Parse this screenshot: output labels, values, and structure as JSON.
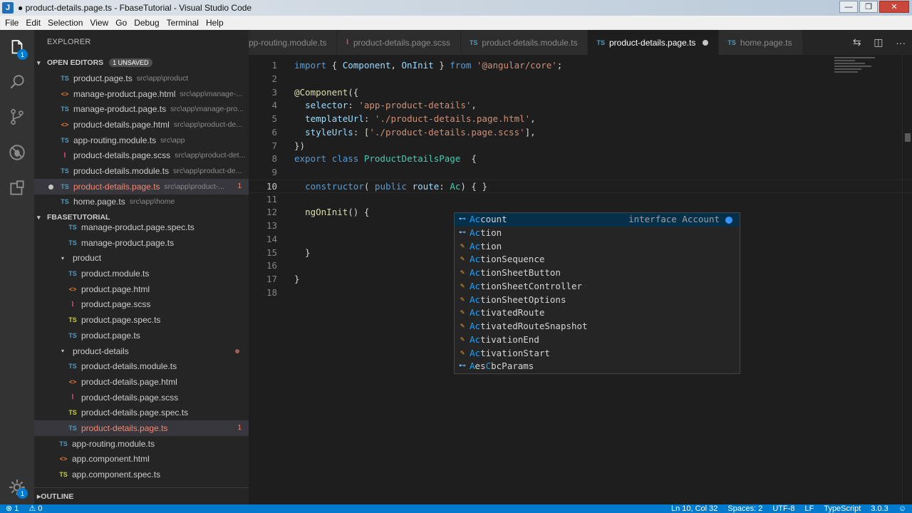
{
  "window": {
    "title": "● product-details.page.ts - FbaseTutorial - Visual Studio Code",
    "app_icon": "J",
    "controls": [
      "—",
      "❐",
      "✕"
    ]
  },
  "menu": [
    "File",
    "Edit",
    "Selection",
    "View",
    "Go",
    "Debug",
    "Terminal",
    "Help"
  ],
  "activity": {
    "explorer_badge": "1",
    "settings_badge": "1",
    "icons": [
      "files-icon",
      "search-icon",
      "source-control-icon",
      "debug-icon",
      "extensions-icon",
      "gear-icon"
    ]
  },
  "sidebar": {
    "title": "EXPLORER",
    "open_editors": {
      "label": "OPEN EDITORS",
      "badge": "1 UNSAVED",
      "items": [
        {
          "icon": "TS",
          "type": "ts",
          "name": "product.page.ts",
          "path": "src\\app\\product"
        },
        {
          "icon": "<>",
          "type": "html",
          "name": "manage-product.page.html",
          "path": "src\\app\\manage-..."
        },
        {
          "icon": "TS",
          "type": "ts",
          "name": "manage-product.page.ts",
          "path": "src\\app\\manage-pro..."
        },
        {
          "icon": "<>",
          "type": "html",
          "name": "product-details.page.html",
          "path": "src\\app\\product-de..."
        },
        {
          "icon": "TS",
          "type": "ts",
          "name": "app-routing.module.ts",
          "path": "src\\app"
        },
        {
          "icon": "⌇",
          "type": "scss",
          "name": "product-details.page.scss",
          "path": "src\\app\\product-det..."
        },
        {
          "icon": "TS",
          "type": "ts",
          "name": "product-details.module.ts",
          "path": "src\\app\\product-de..."
        },
        {
          "icon": "TS",
          "type": "ts",
          "name": "product-details.page.ts",
          "path": "src\\app\\product-...",
          "count": "1",
          "modified": true,
          "selected": true
        },
        {
          "icon": "TS",
          "type": "ts",
          "name": "home.page.ts",
          "path": "src\\app\\home"
        }
      ]
    },
    "workspace": {
      "label": "FBASETUTORIAL",
      "items": [
        {
          "icon": "TS",
          "type": "ts",
          "name": "manage-product.page.spec.ts",
          "indent": 2
        },
        {
          "icon": "TS",
          "type": "ts",
          "name": "manage-product.page.ts",
          "indent": 2
        },
        {
          "icon": "▾",
          "type": "folder",
          "name": "product",
          "indent": 1
        },
        {
          "icon": "TS",
          "type": "ts",
          "name": "product.module.ts",
          "indent": 2
        },
        {
          "icon": "<>",
          "type": "html",
          "name": "product.page.html",
          "indent": 2
        },
        {
          "icon": "⌇",
          "type": "scss",
          "name": "product.page.scss",
          "indent": 2
        },
        {
          "icon": "TS",
          "type": "spec",
          "name": "product.page.spec.ts",
          "indent": 2
        },
        {
          "icon": "TS",
          "type": "ts",
          "name": "product.page.ts",
          "indent": 2
        },
        {
          "icon": "▾",
          "type": "folder",
          "name": "product-details",
          "indent": 1,
          "error": true
        },
        {
          "icon": "TS",
          "type": "ts",
          "name": "product-details.module.ts",
          "indent": 2
        },
        {
          "icon": "<>",
          "type": "html",
          "name": "product-details.page.html",
          "indent": 2
        },
        {
          "icon": "⌇",
          "type": "scss",
          "name": "product-details.page.scss",
          "indent": 2
        },
        {
          "icon": "TS",
          "type": "spec",
          "name": "product-details.page.spec.ts",
          "indent": 2
        },
        {
          "icon": "TS",
          "type": "ts",
          "name": "product-details.page.ts",
          "indent": 2,
          "count": "1",
          "selected": true
        },
        {
          "icon": "TS",
          "type": "ts",
          "name": "app-routing.module.ts",
          "indent": 1
        },
        {
          "icon": "<>",
          "type": "html",
          "name": "app.component.html",
          "indent": 1
        },
        {
          "icon": "TS",
          "type": "spec",
          "name": "app.component.spec.ts",
          "indent": 1
        },
        {
          "icon": "TS",
          "type": "ts",
          "name": "app.component.ts",
          "indent": 1
        }
      ]
    },
    "outline_label": "OUTLINE"
  },
  "tabs": [
    {
      "icon": "",
      "type": "ts",
      "name": "pp-routing.module.ts"
    },
    {
      "icon": "⌇",
      "type": "scss",
      "name": "product-details.page.scss"
    },
    {
      "icon": "TS",
      "type": "ts",
      "name": "product-details.module.ts"
    },
    {
      "icon": "TS",
      "type": "ts",
      "name": "product-details.page.ts",
      "active": true,
      "modified": true
    },
    {
      "icon": "TS",
      "type": "ts",
      "name": "home.page.ts"
    }
  ],
  "tab_actions": [
    "⇆",
    "◫",
    "···"
  ],
  "code": {
    "current_line": 10,
    "lines": [
      [
        [
          "kw",
          "import"
        ],
        [
          "p",
          " { "
        ],
        [
          "var",
          "Component"
        ],
        [
          "p",
          ", "
        ],
        [
          "var",
          "OnInit"
        ],
        [
          "p",
          " } "
        ],
        [
          "kw",
          "from"
        ],
        [
          "p",
          " "
        ],
        [
          "str",
          "'@angular/core'"
        ],
        [
          "p",
          ";"
        ]
      ],
      [],
      [
        [
          "fn",
          "@Component"
        ],
        [
          "p",
          "({"
        ]
      ],
      [
        [
          "p",
          "  "
        ],
        [
          "var",
          "selector"
        ],
        [
          "p",
          ": "
        ],
        [
          "str",
          "'app-product-details'"
        ],
        [
          "p",
          ","
        ]
      ],
      [
        [
          "p",
          "  "
        ],
        [
          "var",
          "templateUrl"
        ],
        [
          "p",
          ": "
        ],
        [
          "str",
          "'./product-details.page.html'"
        ],
        [
          "p",
          ","
        ]
      ],
      [
        [
          "p",
          "  "
        ],
        [
          "var",
          "styleUrls"
        ],
        [
          "p",
          ": ["
        ],
        [
          "str",
          "'./product-details.page.scss'"
        ],
        [
          "p",
          "],"
        ]
      ],
      [
        [
          "p",
          "})"
        ]
      ],
      [
        [
          "kw",
          "export"
        ],
        [
          "p",
          " "
        ],
        [
          "kw",
          "class"
        ],
        [
          "p",
          " "
        ],
        [
          "cls",
          "ProductDetailsPage"
        ],
        [
          "p",
          "  {"
        ]
      ],
      [],
      [
        [
          "p",
          "  "
        ],
        [
          "kw",
          "constructor"
        ],
        [
          "p",
          "( "
        ],
        [
          "kw",
          "public"
        ],
        [
          "p",
          " "
        ],
        [
          "var",
          "route"
        ],
        [
          "p",
          ": "
        ],
        [
          "cls",
          "Ac"
        ],
        [
          "p",
          ") { }"
        ]
      ],
      [],
      [
        [
          "p",
          "  "
        ],
        [
          "fn",
          "ngOnInit"
        ],
        [
          "p",
          "() {"
        ]
      ],
      [],
      [],
      [
        [
          "p",
          "  }"
        ]
      ],
      [],
      [
        [
          "p",
          "}"
        ]
      ],
      []
    ]
  },
  "suggestions": {
    "items": [
      {
        "kind": "iface",
        "match": "Ac",
        "rest": "count",
        "detail": "interface Account",
        "selected": true
      },
      {
        "kind": "iface",
        "match": "Ac",
        "rest": "tion"
      },
      {
        "kind": "cls",
        "match": "Ac",
        "rest": "tion"
      },
      {
        "kind": "cls",
        "match": "Ac",
        "rest": "tionSequence"
      },
      {
        "kind": "cls",
        "match": "Ac",
        "rest": "tionSheetButton"
      },
      {
        "kind": "cls",
        "match": "Ac",
        "rest": "tionSheetController"
      },
      {
        "kind": "cls",
        "match": "Ac",
        "rest": "tionSheetOptions"
      },
      {
        "kind": "cls",
        "match": "Ac",
        "rest": "tivatedRoute"
      },
      {
        "kind": "cls",
        "match": "Ac",
        "rest": "tivatedRouteSnapshot"
      },
      {
        "kind": "cls",
        "match": "Ac",
        "rest": "tivationEnd"
      },
      {
        "kind": "cls",
        "match": "Ac",
        "rest": "tivationStart"
      },
      {
        "kind": "iface",
        "match": "A",
        "rest": "esCbcParams",
        "extra_match": "C"
      }
    ]
  },
  "status": {
    "left": [
      "⊗ 1",
      "⚠ 0"
    ],
    "right": [
      "Ln 10, Col 32",
      "Spaces: 2",
      "UTF-8",
      "LF",
      "TypeScript",
      "3.0.3",
      "☺"
    ]
  }
}
